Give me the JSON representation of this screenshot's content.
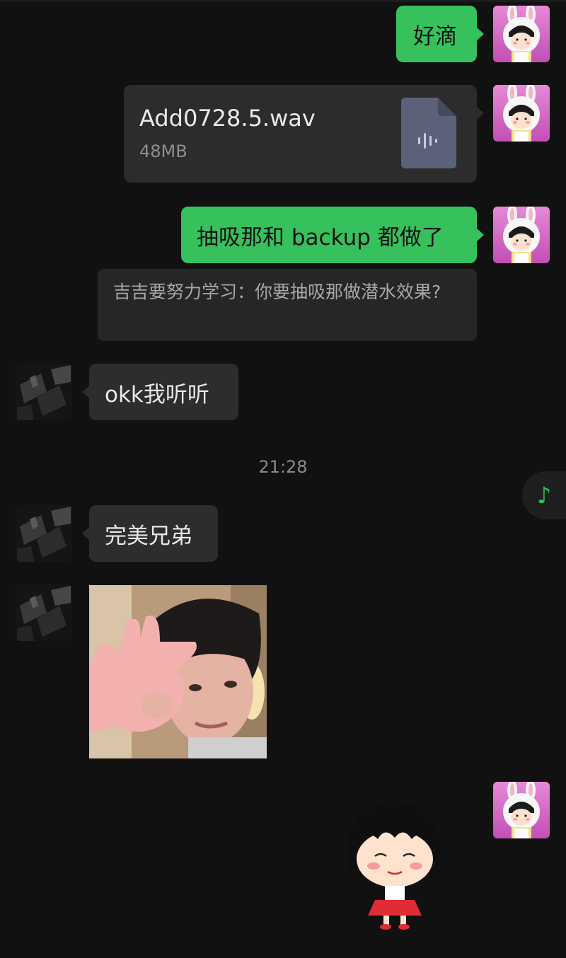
{
  "chat": {
    "messages": {
      "m1": {
        "text": "好滴"
      },
      "m2": {
        "file_name": "Add0728.5.wav",
        "file_size": "48MB",
        "icon": "audio-file-icon"
      },
      "m3": {
        "text": "抽吸那和 backup 都做了"
      },
      "m3_quote": {
        "text": "吉吉要努力学习：你要抽吸那做潜水效果?"
      },
      "m4": {
        "text": "okk我听听"
      },
      "time": "21:28",
      "m5": {
        "text": "完美兄弟"
      },
      "m6": {
        "image": "photo-person-ok-gesture"
      },
      "m7": {
        "sticker": "cartoon-girl-sticker"
      }
    }
  },
  "floating": {
    "icon": "music-note-icon",
    "glyph": "♪",
    "color": "#2cc258"
  },
  "colors": {
    "background": "#111111",
    "bubble_me": "#37c15c",
    "bubble_other": "#2d2d2d"
  }
}
